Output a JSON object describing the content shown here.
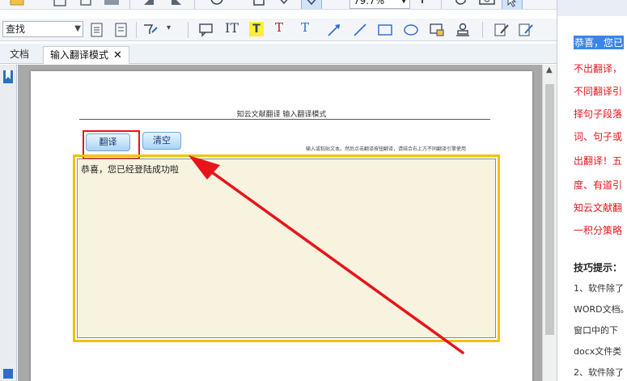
{
  "toolbar": {
    "find_label": "查找",
    "zoom_value": "79.7%"
  },
  "tabs": [
    {
      "label": "文档"
    },
    {
      "label": "输入翻译模式",
      "close": "✕"
    }
  ],
  "document": {
    "title": "知云文献翻译  输入翻译模式",
    "translate_button": "翻译",
    "clear_button": "清空",
    "hint": "输入或粘贴文本。然后点击翻译按钮翻译，请结合右上方不同翻译引擎使用",
    "input_text": "恭喜，您已经登陆成功啦"
  },
  "colors": {
    "highlight_red": "#e8141b",
    "frame_yellow": "#f2c100",
    "input_bg": "#f8f3df",
    "selection_blue": "#3a86e8"
  },
  "right_panel": {
    "lines": [
      {
        "text": "恭喜，您已",
        "style": "sel"
      },
      {
        "text": "不出翻译，",
        "style": "red"
      },
      {
        "text": "不同翻译引",
        "style": "red"
      },
      {
        "text": "择句子段落",
        "style": "red"
      },
      {
        "text": "词、句子或",
        "style": "red"
      },
      {
        "text": "出翻译！五",
        "style": "red"
      },
      {
        "text": "度、有道引",
        "style": "red"
      },
      {
        "text": "知云文献翻",
        "style": "red"
      },
      {
        "text": "一积分策略",
        "style": "red"
      },
      {
        "text": "技巧提示：",
        "style": "bold"
      },
      {
        "text": "1、软件除了",
        "style": "small"
      },
      {
        "text": "WORD文档。",
        "style": "small"
      },
      {
        "text": "窗口中的下",
        "style": "small"
      },
      {
        "text": "docx文件类",
        "style": "small"
      },
      {
        "text": "2、软件除了",
        "style": "small"
      }
    ]
  }
}
